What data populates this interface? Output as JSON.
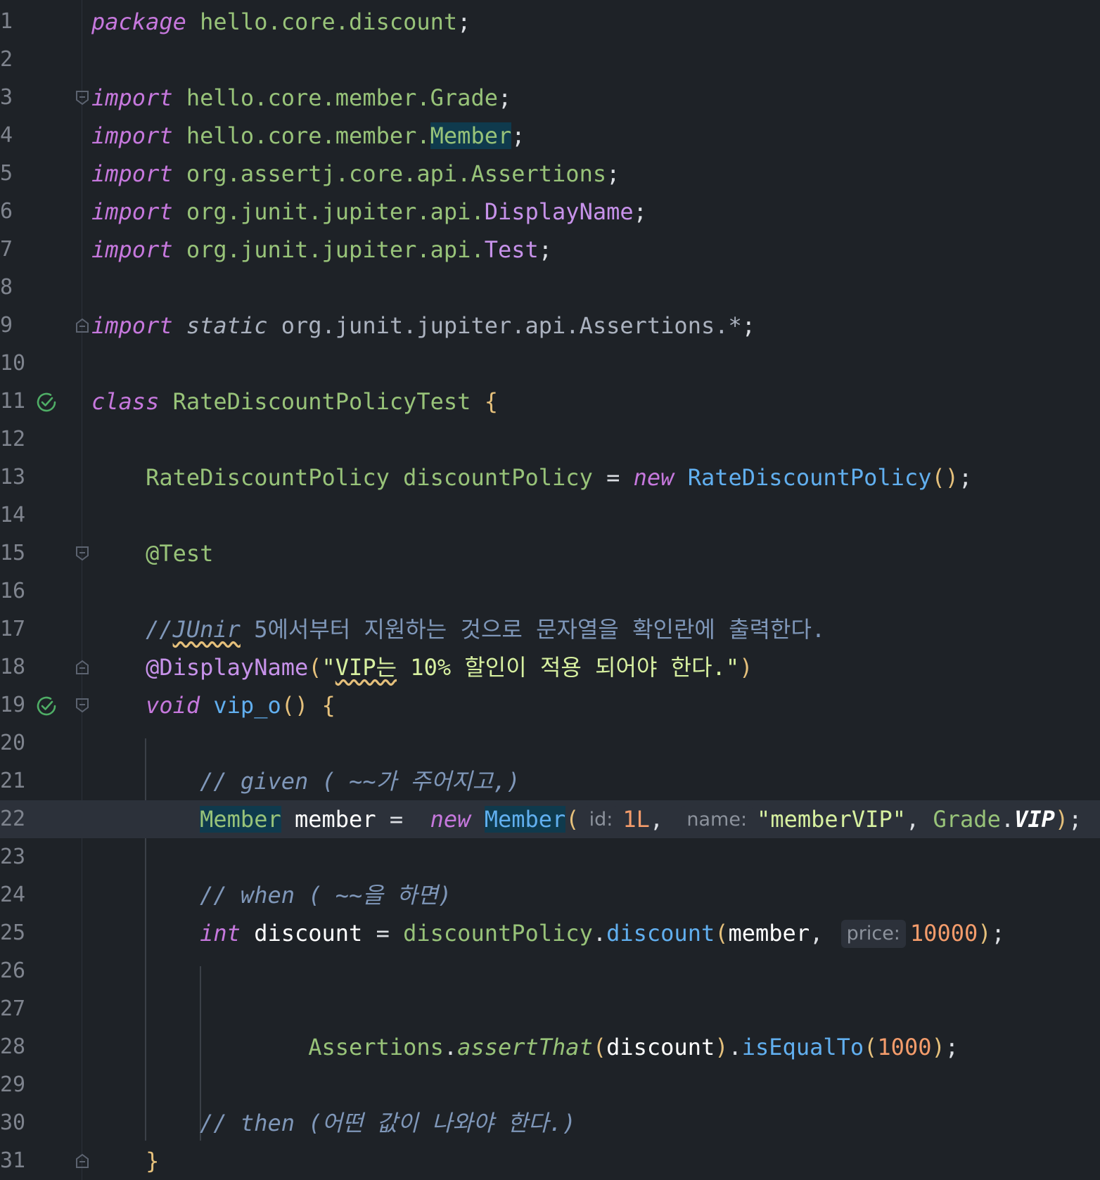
{
  "editor": {
    "language": "java",
    "current_line": 22,
    "lines": [
      {
        "n": "1",
        "code": "package hello.core.discount;"
      },
      {
        "n": "2",
        "code": ""
      },
      {
        "n": "3",
        "code": "import hello.core.member.Grade;"
      },
      {
        "n": "4",
        "code": "import hello.core.member.Member;"
      },
      {
        "n": "5",
        "code": "import org.assertj.core.api.Assertions;"
      },
      {
        "n": "6",
        "code": "import org.junit.jupiter.api.DisplayName;"
      },
      {
        "n": "7",
        "code": "import org.junit.jupiter.api.Test;"
      },
      {
        "n": "8",
        "code": ""
      },
      {
        "n": "9",
        "code": "import static org.junit.jupiter.api.Assertions.*;"
      },
      {
        "n": "10",
        "code": ""
      },
      {
        "n": "11",
        "code": "class RateDiscountPolicyTest {"
      },
      {
        "n": "12",
        "code": ""
      },
      {
        "n": "13",
        "code": "    RateDiscountPolicy discountPolicy = new RateDiscountPolicy();"
      },
      {
        "n": "14",
        "code": ""
      },
      {
        "n": "15",
        "code": "    @Test"
      },
      {
        "n": "16",
        "code": ""
      },
      {
        "n": "17",
        "code": "    //JUnir 5에서부터 지원하는 것으로 문자열을 확인란에 출력한다."
      },
      {
        "n": "18",
        "code": "    @DisplayName(\"VIP는 10% 할인이 적용 되어야 한다.\")"
      },
      {
        "n": "19",
        "code": "    void vip_o() {"
      },
      {
        "n": "20",
        "code": ""
      },
      {
        "n": "21",
        "code": "        // given ( ~~가 주어지고,)"
      },
      {
        "n": "22",
        "code": "        Member member =  new Member( 1L, \"memberVIP\", Grade.VIP);"
      },
      {
        "n": "23",
        "code": ""
      },
      {
        "n": "24",
        "code": "        // when ( ~~을 하면)"
      },
      {
        "n": "25",
        "code": "        int discount = discountPolicy.discount(member, 10000);"
      },
      {
        "n": "26",
        "code": ""
      },
      {
        "n": "27",
        "code": ""
      },
      {
        "n": "28",
        "code": "                Assertions.assertThat(discount).isEqualTo(1000);"
      },
      {
        "n": "29",
        "code": ""
      },
      {
        "n": "30",
        "code": "        // then (어떤 값이 나와야 한다.)"
      },
      {
        "n": "31",
        "code": "    }"
      }
    ],
    "tokens": {
      "package_kw": "package",
      "package_name": "hello.core.discount",
      "import_kw": "import",
      "static_kw": "static",
      "semicolon": ";",
      "imp_grade": "hello.core.member.Grade",
      "imp_member_prefix": "hello.core.member.",
      "imp_member_cls": "Member",
      "imp_assertions_pkg": "org.assertj.core.api.",
      "imp_assertions_cls": "Assertions",
      "imp_displayname_pkg": "org.junit.jupiter.api.",
      "imp_displayname_cls": "DisplayName",
      "imp_test_pkg": "org.junit.jupiter.api.",
      "imp_test_cls": "Test",
      "imp_static": "org.junit.jupiter.api.Assertions.*",
      "class_kw": "class",
      "class_name": "RateDiscountPolicyTest",
      "open_brace": "{",
      "close_brace": "}",
      "field_type": "RateDiscountPolicy",
      "field_name": "discountPolicy",
      "equals": "=",
      "new_kw": "new",
      "ctor_name": "RateDiscountPolicy",
      "parens": "()",
      "anno_test": "@Test",
      "comment_17_prefix": "//",
      "comment_17_squiggle": "JUnir",
      "comment_17_rest": " 5에서부터 지원하는 것으로 문자열을 확인란에 출력한다.",
      "anno_displayname": "@DisplayName",
      "open_paren": "(",
      "close_paren": ")",
      "str_open": "\"",
      "str_squiggle": "VIP는",
      "str_rest": " 10% 할인이 적용 되어야 한다.\"",
      "void_kw": "void",
      "method_name": "vip_o",
      "comment_given": "// given ( ~~가 주어지고,)",
      "member_type": "Member",
      "member_var": "member",
      "member_ctor": "Member",
      "hint_id": "id:",
      "num_1l": "1L",
      "comma": ",",
      "hint_name": "name:",
      "str_member_vip": "\"memberVIP\"",
      "grade_cls": "Grade",
      "dot": ".",
      "grade_vip": "VIP",
      "comment_when": "// when ( ~~을 하면)",
      "int_kw": "int",
      "discount_var": "discount",
      "discount_policy_ref": "discountPolicy",
      "discount_method": "discount",
      "hint_price": "price:",
      "num_10000": "10000",
      "assertions_cls": "Assertions",
      "assert_that": "assertThat",
      "is_equal_to": "isEqualTo",
      "num_1000": "1000",
      "comment_then": "// then (어떤 값이 나와야 한다.)"
    }
  },
  "colors": {
    "background": "#1e2227",
    "current_line": "#2c313a",
    "keyword": "#c678dd",
    "type": "#98c379",
    "method": "#61afef",
    "number": "#f49c6b",
    "string": "#d7f0a0",
    "comment": "#7f97b9",
    "identifier_highlight": "#0f3a4d",
    "run_icon": "#4fae66"
  },
  "icons": {
    "run": "run-test-check-icon",
    "fold": "fold-marker-icon"
  }
}
